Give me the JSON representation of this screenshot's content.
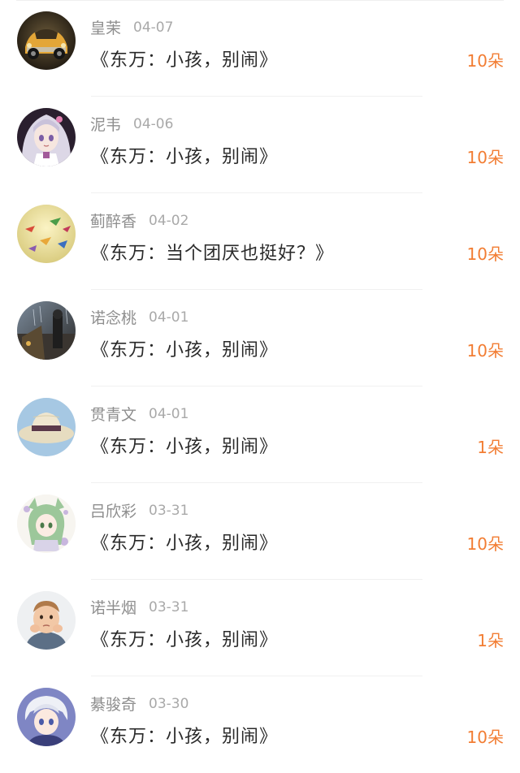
{
  "reward_list": [
    {
      "user": "皇茉",
      "date": "04-07",
      "work_title": "《东万：小孩，别闹》",
      "amount": "10朵",
      "avatar_icon": "vintage-car-avatar-icon"
    },
    {
      "user": "泥韦",
      "date": "04-06",
      "work_title": "《东万：小孩，别闹》",
      "amount": "10朵",
      "avatar_icon": "anime-girl-silver-hair-avatar-icon"
    },
    {
      "user": "蓟醉香",
      "date": "04-02",
      "work_title": "《东万：当个团厌也挺好？》",
      "amount": "10朵",
      "avatar_icon": "paper-cranes-avatar-icon"
    },
    {
      "user": "诺念桃",
      "date": "04-01",
      "work_title": "《东万：小孩，别闹》",
      "amount": "10朵",
      "avatar_icon": "rainy-street-avatar-icon"
    },
    {
      "user": "贯青文",
      "date": "04-01",
      "work_title": "《东万：小孩，别闹》",
      "amount": "1朵",
      "avatar_icon": "straw-hat-avatar-icon"
    },
    {
      "user": "吕欣彩",
      "date": "03-31",
      "work_title": "《东万：小孩，别闹》",
      "amount": "10朵",
      "avatar_icon": "green-hair-anime-girl-avatar-icon"
    },
    {
      "user": "诺半烟",
      "date": "03-31",
      "work_title": "《东万：小孩，别闹》",
      "amount": "1朵",
      "avatar_icon": "child-photo-avatar-icon"
    },
    {
      "user": "綦骏奇",
      "date": "03-30",
      "work_title": "《东万：小孩，别闹》",
      "amount": "10朵",
      "avatar_icon": "anime-boy-white-hair-avatar-icon"
    }
  ],
  "colors": {
    "amount": "#f27d33",
    "name": "#8e8e8e",
    "date": "#a9a9a9",
    "title": "#2a2a2a"
  }
}
